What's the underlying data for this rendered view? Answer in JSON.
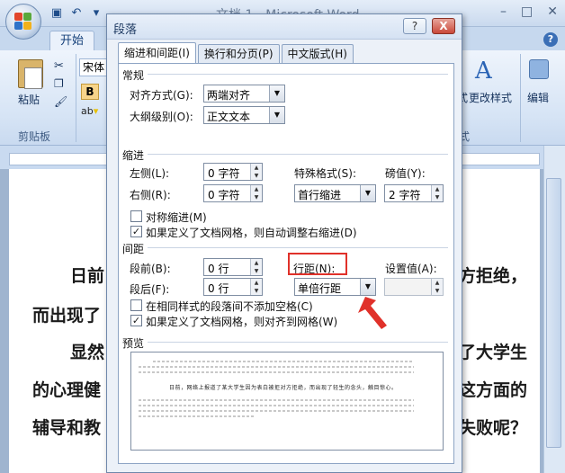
{
  "window": {
    "title": "文档 1 - Microsoft Word"
  },
  "ribbon": {
    "home_tab": "开始",
    "font_name": "宋体",
    "bold": "B",
    "paste": "粘贴",
    "clipboard_group": "剪贴板",
    "change_styles": "更改样式",
    "styles_partial": "式",
    "styles_group_partial": "式",
    "editing": "编辑"
  },
  "document": {
    "lines": [
      "日前",
      "方拒绝，",
      "而出现了",
      "显然",
      "了大学生",
      "的心理健",
      "这方面的",
      "辅导和教",
      "失败呢？"
    ]
  },
  "dialog": {
    "title": "段落",
    "help": "?",
    "close": "X",
    "tabs": [
      "缩进和间距(I)",
      "换行和分页(P)",
      "中文版式(H)"
    ],
    "general": {
      "title": "常规",
      "alignment_label": "对齐方式(G):",
      "alignment_value": "两端对齐",
      "outline_label": "大纲级别(O):",
      "outline_value": "正文文本"
    },
    "indent": {
      "title": "缩进",
      "left_label": "左侧(L):",
      "left_value": "0 字符",
      "right_label": "右侧(R):",
      "right_value": "0 字符",
      "special_label": "特殊格式(S):",
      "special_value": "首行缩进",
      "by_label": "磅值(Y):",
      "by_value": "2 字符",
      "mirror_label": "对称缩进(M)",
      "auto_adjust_label": "如果定义了文档网格，则自动调整右缩进(D)"
    },
    "spacing": {
      "title": "间距",
      "before_label": "段前(B):",
      "before_value": "0 行",
      "after_label": "段后(F):",
      "after_value": "0 行",
      "line_spacing_label": "行距(N):",
      "line_spacing_value": "单倍行距",
      "at_label": "设置值(A):",
      "no_space_label": "在相同样式的段落间不添加空格(C)",
      "snap_grid_label": "如果定义了文档网格，则对齐到网格(W)"
    },
    "preview": {
      "title": "预览",
      "sample_text": "日前，网络上报道了某大学生因为表白被拒对方拒绝，而出现了轻生的念头，触目惊心。"
    }
  },
  "colors": {
    "highlight": "#e0312a",
    "ribbon": "#d6e4f5",
    "dialog_bg": "#ecf1f8"
  }
}
